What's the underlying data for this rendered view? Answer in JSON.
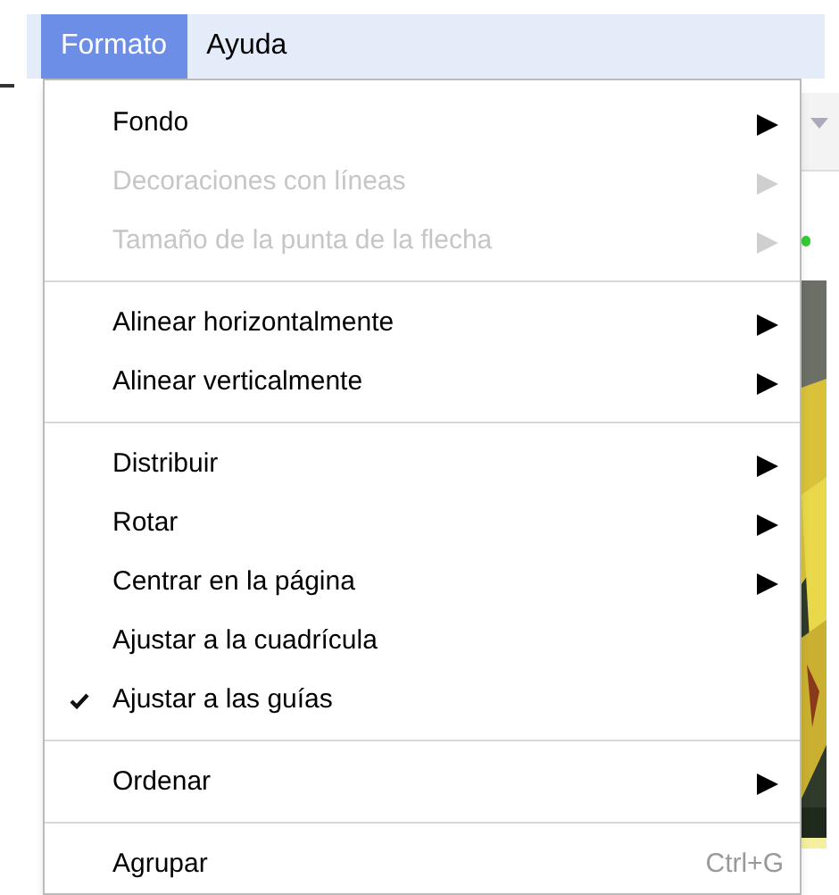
{
  "menubar": [
    {
      "label": "Formato",
      "selected": true
    },
    {
      "label": "Ayuda",
      "selected": false
    }
  ],
  "menu": {
    "groups": [
      [
        {
          "kind": "submenu",
          "label": "Fondo",
          "disabled": false
        },
        {
          "kind": "submenu",
          "label": "Decoraciones con líneas",
          "disabled": true
        },
        {
          "kind": "submenu",
          "label": "Tamaño de la punta de la flecha",
          "disabled": true
        }
      ],
      [
        {
          "kind": "submenu",
          "label": "Alinear horizontalmente",
          "disabled": false
        },
        {
          "kind": "submenu",
          "label": "Alinear verticalmente",
          "disabled": false
        }
      ],
      [
        {
          "kind": "submenu",
          "label": "Distribuir",
          "disabled": false
        },
        {
          "kind": "submenu",
          "label": "Rotar",
          "disabled": false
        },
        {
          "kind": "submenu",
          "label": "Centrar en la página",
          "disabled": false
        },
        {
          "kind": "toggle",
          "label": "Ajustar a la cuadrícula",
          "disabled": false,
          "checked": false
        },
        {
          "kind": "toggle",
          "label": "Ajustar a las guías",
          "disabled": false,
          "checked": true
        }
      ],
      [
        {
          "kind": "submenu",
          "label": "Ordenar",
          "disabled": false
        }
      ],
      [
        {
          "kind": "shortcut",
          "label": "Agrupar",
          "disabled": false,
          "shortcut": "Ctrl+G"
        }
      ]
    ]
  }
}
